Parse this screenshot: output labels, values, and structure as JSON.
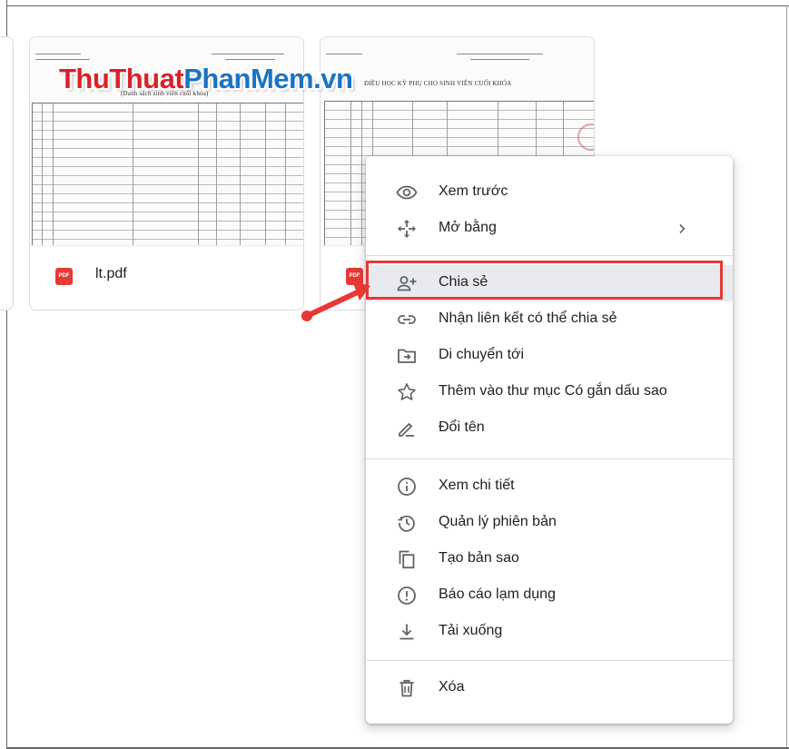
{
  "watermark": {
    "part1": "ThuThuat",
    "part2": "PhanMem",
    "part3": ".vn"
  },
  "files": [
    {
      "name": "lt.pdf",
      "type_badge": "PDF",
      "thumb_title": "(Danh sách sinh viên cuối khóa)"
    },
    {
      "name": "",
      "type_badge": "PDF",
      "thumb_title": "ĐIỀU HỌC KỲ PHỤ CHO SINH VIÊN CUỐI KHÓA"
    }
  ],
  "context_menu": {
    "items": [
      {
        "label": "Xem trước",
        "icon": "eye-icon"
      },
      {
        "label": "Mở bằng",
        "icon": "move-arrows-icon",
        "submenu": true
      },
      {
        "label": "Chia sẻ",
        "icon": "add-person-icon",
        "highlighted": true
      },
      {
        "label": "Nhận liên kết có thể chia sẻ",
        "icon": "link-icon"
      },
      {
        "label": "Di chuyển tới",
        "icon": "folder-move-icon"
      },
      {
        "label": "Thêm vào thư mục Có gắn dấu sao",
        "icon": "star-icon"
      },
      {
        "label": "Đổi tên",
        "icon": "pencil-icon"
      },
      {
        "label": "Xem chi tiết",
        "icon": "info-icon"
      },
      {
        "label": "Quản lý phiên bản",
        "icon": "history-icon"
      },
      {
        "label": "Tạo bản sao",
        "icon": "copy-icon"
      },
      {
        "label": "Báo cáo lạm dụng",
        "icon": "report-icon"
      },
      {
        "label": "Tải xuống",
        "icon": "download-icon"
      },
      {
        "label": "Xóa",
        "icon": "trash-icon"
      }
    ]
  },
  "colors": {
    "accent_red": "#e53935",
    "watermark_red": "#d9222a",
    "watermark_blue": "#1a73c4",
    "highlight": "#e8eaed"
  }
}
